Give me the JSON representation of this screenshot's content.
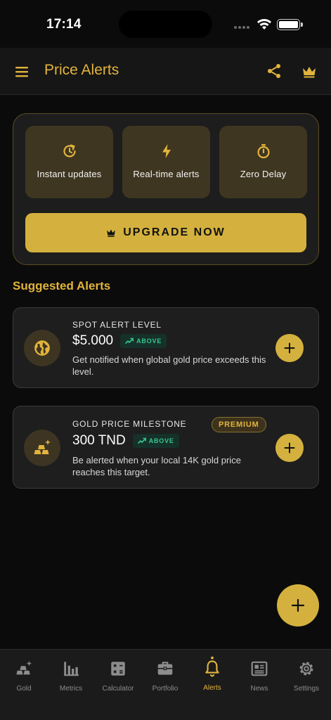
{
  "status_bar": {
    "time": "17:14"
  },
  "header": {
    "title": "Price Alerts"
  },
  "upgrade": {
    "features": [
      {
        "label": "Instant updates",
        "icon": "refresh-clock-icon"
      },
      {
        "label": "Real-time alerts",
        "icon": "lightning-icon"
      },
      {
        "label": "Zero Delay",
        "icon": "stopwatch-icon"
      }
    ],
    "button_label": "UPGRADE NOW"
  },
  "suggested": {
    "title": "Suggested Alerts",
    "alerts": [
      {
        "kicker": "SPOT ALERT LEVEL",
        "value": "$5.000",
        "direction": "ABOVE",
        "description": "Get notified when global gold price exceeds this level.",
        "icon": "globe-icon"
      },
      {
        "kicker": "GOLD PRICE MILESTONE",
        "value": "300 TND",
        "direction": "ABOVE",
        "badge": "PREMIUM",
        "description": "Be alerted when your local 14K gold price reaches this target.",
        "icon": "gold-bars-icon"
      }
    ]
  },
  "tabs": [
    {
      "label": "Gold",
      "icon": "gold-bars-icon",
      "active": false
    },
    {
      "label": "Metrics",
      "icon": "bar-chart-icon",
      "active": false
    },
    {
      "label": "Calculator",
      "icon": "calculator-icon",
      "active": false
    },
    {
      "label": "Portfolio",
      "icon": "briefcase-icon",
      "active": false
    },
    {
      "label": "Alerts",
      "icon": "bell-icon",
      "active": true
    },
    {
      "label": "News",
      "icon": "newspaper-icon",
      "active": false
    },
    {
      "label": "Settings",
      "icon": "gear-icon",
      "active": false
    }
  ],
  "colors": {
    "accent": "#d4b13e",
    "accent_text": "#e3b43c",
    "background": "#0b0b0b",
    "card": "#1e1e1e",
    "positive": "#37c88f"
  }
}
